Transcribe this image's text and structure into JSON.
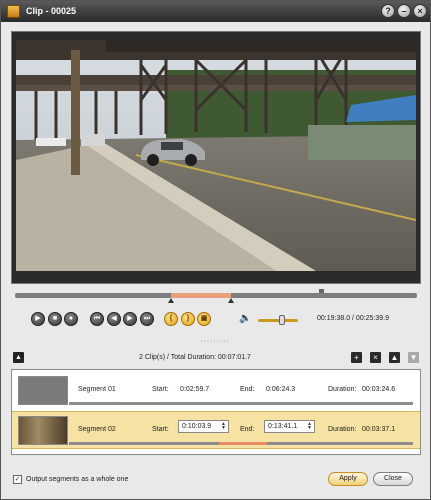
{
  "window": {
    "title": "Clip - 00025"
  },
  "player": {
    "time_readout": "00:19:38.0 / 00:25:39.9",
    "volume_level": 0.6,
    "controls": [
      "play-icon",
      "stop-icon",
      "record-icon",
      "skip-start-icon",
      "prev-frame-icon",
      "next-frame-icon",
      "skip-end-icon",
      "mark-in-icon",
      "mark-out-icon",
      "snapshot-icon",
      "volume-icon"
    ]
  },
  "segments_toolbar": {
    "summary_clips": "2 Clip(s) /",
    "summary_duration": "Total Duration: 00:07:01.7"
  },
  "segments": [
    {
      "name": "Segment 01",
      "start_label": "Start:",
      "start": "0:02:59.7",
      "end_label": "End:",
      "end": "0:06:24.3",
      "duration_label": "Duration:",
      "duration": "00:03:24.6",
      "selected": false
    },
    {
      "name": "Segment 02",
      "start_label": "Start:",
      "start": "0:10:03.9",
      "end_label": "End:",
      "end": "0:13:41.1",
      "duration_label": "Duration:",
      "duration": "00:03:37.1",
      "selected": true
    }
  ],
  "footer": {
    "checkbox_label": "Output segments as a whole one",
    "checked": true,
    "apply": "Apply",
    "close": "Close"
  },
  "colors": {
    "accent": "#e8a07b",
    "selected_row": "#f6e2a2",
    "titlebar": "#3a3a3a"
  }
}
